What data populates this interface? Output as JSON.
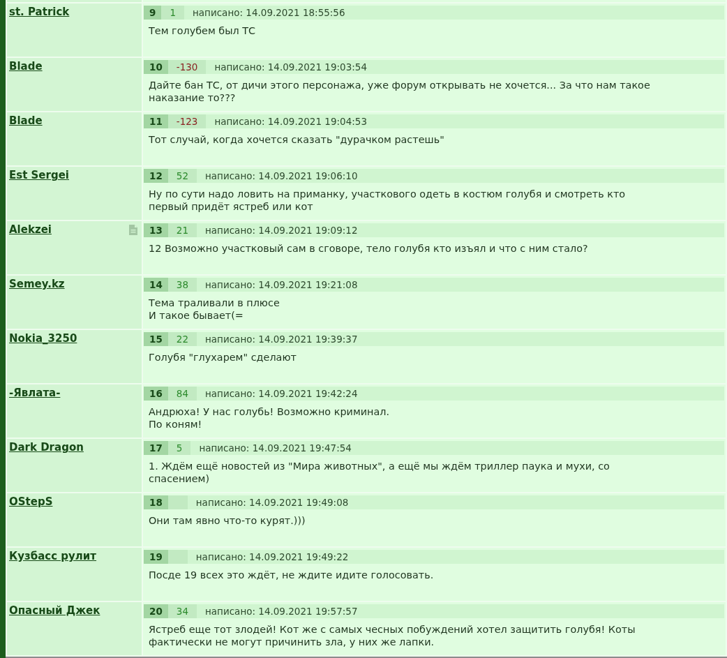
{
  "posts": [
    {
      "author": "st. Patrick",
      "note_icon": false,
      "number": "9",
      "rating": {
        "text": "1",
        "negative": false
      },
      "date": "написано: 14.09.2021 18:55:56",
      "message": "Тем голубем был ТС"
    },
    {
      "author": "Blade",
      "note_icon": false,
      "number": "10",
      "rating": {
        "text": "-130",
        "negative": true
      },
      "date": "написано: 14.09.2021 19:03:54",
      "message": "Дайте бан ТС, от дичи этого персонажа, уже форум открывать не хочется... За что нам такое наказание то???"
    },
    {
      "author": "Blade",
      "note_icon": false,
      "number": "11",
      "rating": {
        "text": "-123",
        "negative": true
      },
      "date": "написано: 14.09.2021 19:04:53",
      "message": "Тот случай, когда хочется сказать \"дурачком растешь\""
    },
    {
      "author": "Est Sergei",
      "note_icon": false,
      "number": "12",
      "rating": {
        "text": "52",
        "negative": false
      },
      "date": "написано: 14.09.2021 19:06:10",
      "message": "Ну по сути надо ловить на приманку, участкового одеть в костюм голубя и смотреть кто первый придёт ястреб или кот"
    },
    {
      "author": "Alekzei",
      "note_icon": true,
      "number": "13",
      "rating": {
        "text": "21",
        "negative": false
      },
      "date": "написано: 14.09.2021 19:09:12",
      "message": "12 Возможно участковый сам в сговоре, тело голубя кто изъял и что с ним стало?"
    },
    {
      "author": "Semey.kz",
      "note_icon": false,
      "number": "14",
      "rating": {
        "text": "38",
        "negative": false
      },
      "date": "написано: 14.09.2021 19:21:08",
      "message": "Тема траливали в плюсе\nИ такое бывает(="
    },
    {
      "author": "Nokia_3250",
      "note_icon": false,
      "number": "15",
      "rating": {
        "text": "22",
        "negative": false
      },
      "date": "написано: 14.09.2021 19:39:37",
      "message": "Голубя \"глухарем\" сделают"
    },
    {
      "author": "-Явлата-",
      "note_icon": false,
      "number": "16",
      "rating": {
        "text": "84",
        "negative": false
      },
      "date": "написано: 14.09.2021 19:42:24",
      "message": "Андрюха! У нас голубь! Возможно криминал.\nПо коням!"
    },
    {
      "author": "Dark Dragon",
      "note_icon": false,
      "number": "17",
      "rating": {
        "text": "5",
        "negative": false
      },
      "date": "написано: 14.09.2021 19:47:54",
      "message": "1. Ждём ещё новостей из \"Мира животных\", а ещё мы ждём триллер паука и мухи, со спасением)"
    },
    {
      "author": "OStepS",
      "note_icon": false,
      "number": "18",
      "date": "написано: 14.09.2021 19:49:08",
      "message": "Они там явно что-то курят.)))"
    },
    {
      "author": "Кузбасс рулит",
      "note_icon": false,
      "number": "19",
      "date": "написано: 14.09.2021 19:49:22",
      "message": "Посде 19 всех это ждёт, не ждите идите голосовать."
    },
    {
      "author": "Опасный Джек",
      "note_icon": false,
      "number": "20",
      "rating": {
        "text": "34",
        "negative": false
      },
      "date": "написано: 14.09.2021 19:57:57",
      "message": "Ястреб еще тот злодей! Кот же с самых чесных побуждений хотел защитить голубя! Коты фактически не могут причинить зла, у них же лапки."
    }
  ]
}
